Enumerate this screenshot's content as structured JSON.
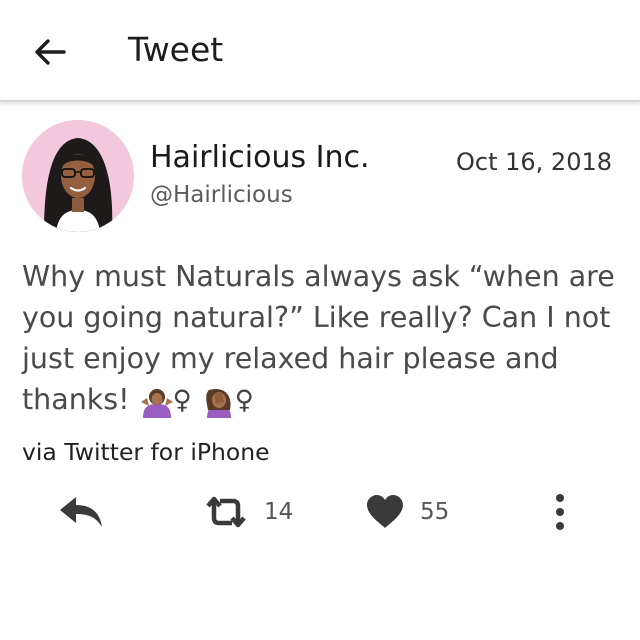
{
  "header": {
    "title": "Tweet",
    "back_icon": "arrow-left-icon"
  },
  "author": {
    "name": "Hairlicious Inc.",
    "handle": "@Hairlicious",
    "avatar": "avatar"
  },
  "tweet": {
    "date": "Oct 16, 2018",
    "text": "Why must Naturals always ask “when are you going natural?” Like really? Can I not just enjoy my relaxed hair please and thanks!",
    "emoji": [
      "woman-shrugging-emoji",
      "woman-facepalming-emoji"
    ],
    "female_sign": "♀",
    "source": "via Twitter for iPhone"
  },
  "actions": {
    "reply_icon": "reply-icon",
    "retweet_icon": "retweet-icon",
    "retweet_count": "14",
    "like_icon": "heart-icon",
    "like_count": "55",
    "more_icon": "more-vertical-icon"
  },
  "colors": {
    "avatar_bg": "#f4c8dc",
    "icon": "#333333",
    "emoji_shirt": "#9a5ec0",
    "emoji_skin": "#a7734f"
  }
}
